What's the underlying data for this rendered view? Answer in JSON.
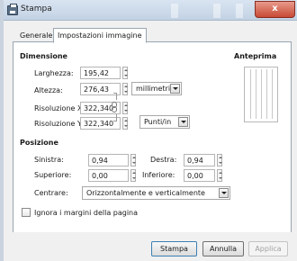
{
  "window": {
    "title": "Stampa",
    "close_glyph": "x"
  },
  "tabs": [
    {
      "label": "Generale"
    },
    {
      "label": "Impostazioni immagine",
      "selected": true
    }
  ],
  "dimensione": {
    "heading": "Dimensione",
    "larghezza_label": "Larghezza:",
    "larghezza_value": "195,42",
    "altezza_label": "Altezza:",
    "altezza_value": "276,43",
    "units_value": "millimetri",
    "risoluzione_x_label": "Risoluzione X:",
    "risoluzione_x_value": "322,340",
    "risoluzione_y_label": "Risoluzione Y:",
    "risoluzione_y_value": "322,340",
    "resolution_units_value": "Punti/in"
  },
  "anteprima": {
    "heading": "Anteprima"
  },
  "posizione": {
    "heading": "Posizione",
    "sinistra_label": "Sinistra:",
    "sinistra_value": "0,94",
    "destra_label": "Destra:",
    "destra_value": "0,94",
    "superiore_label": "Superiore:",
    "superiore_value": "0,00",
    "inferiore_label": "Inferiore:",
    "inferiore_value": "0,00",
    "centrare_label": "Centrare:",
    "centrare_value": "Orizzontalmente e verticalmente"
  },
  "ignore_margins": {
    "label": "Ignora i margini della pagina",
    "checked": false
  },
  "buttons": {
    "print": "Stampa",
    "cancel": "Annulla",
    "apply": "Applica"
  },
  "colors": {
    "titlebar": "#c2d2e4",
    "close": "#c84a35",
    "default_button_border": "#3c7fb1"
  },
  "icons": {
    "app": "printer-icon",
    "chain": "chain-link-icon",
    "dropdown": "chevron-down-icon"
  }
}
